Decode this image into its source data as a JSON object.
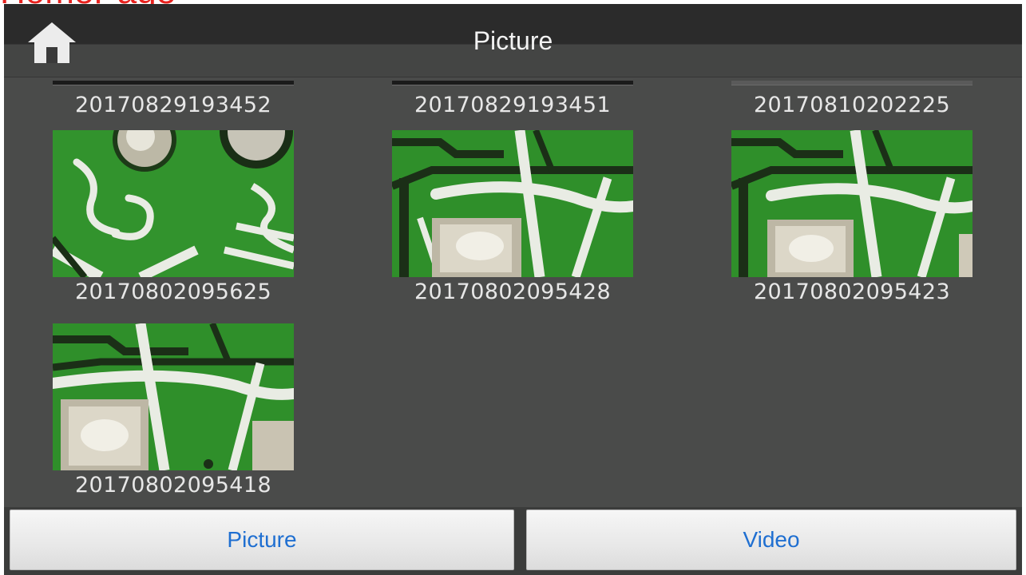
{
  "annotation": {
    "text": "HomePage"
  },
  "header": {
    "title": "Picture",
    "home_icon": "home-icon"
  },
  "gallery": {
    "items": [
      {
        "label": "20170829193452",
        "partial": true
      },
      {
        "label": "20170829193451",
        "partial": true
      },
      {
        "label": "20170810202225",
        "partial": true
      },
      {
        "label": "20170802095625"
      },
      {
        "label": "20170802095428"
      },
      {
        "label": "20170802095423"
      },
      {
        "label": "20170802095418"
      }
    ]
  },
  "bottom_tabs": {
    "picture_label": "Picture",
    "video_label": "Video",
    "label_color": "#1f6fd1"
  },
  "colors": {
    "annotation": "#e8231f",
    "background": "#4a4b4a",
    "pcb_green": "#2f8f2a",
    "silkscreen": "#e9ece4"
  }
}
